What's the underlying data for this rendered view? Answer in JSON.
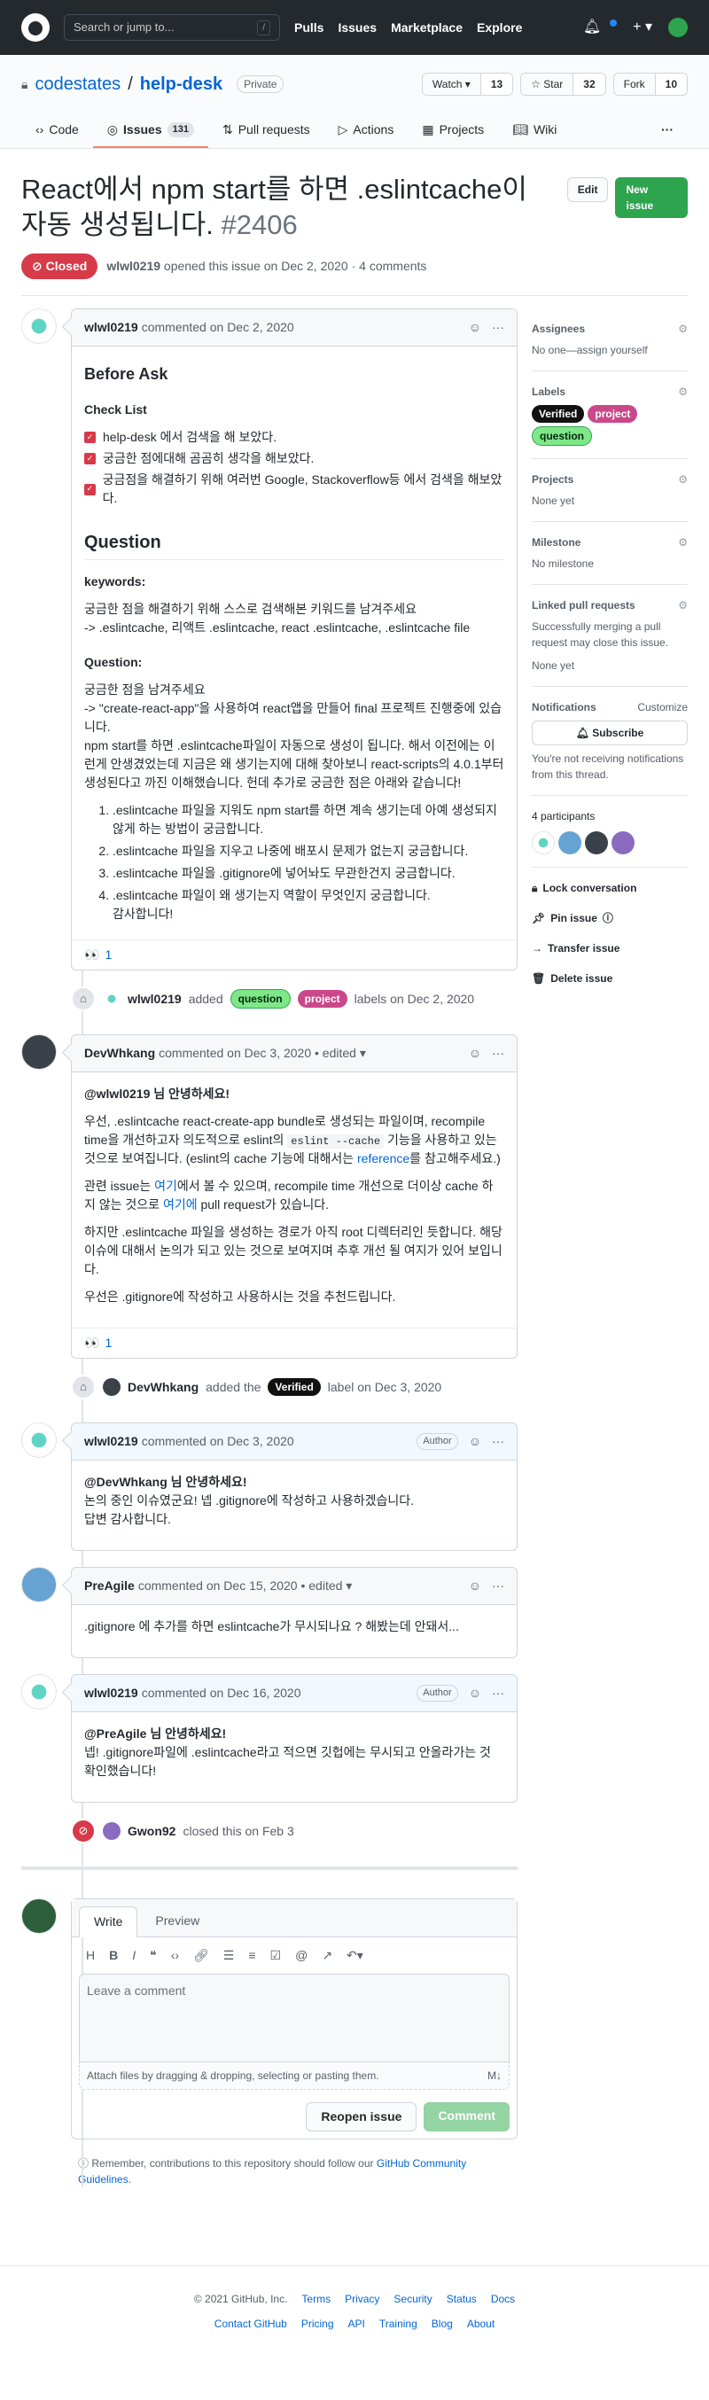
{
  "topbar": {
    "search_placeholder": "Search or jump to...",
    "search_key": "/",
    "nav": [
      "Pulls",
      "Issues",
      "Marketplace",
      "Explore"
    ],
    "plus": "+ ▾",
    "brand_color": "#24292e"
  },
  "repo": {
    "owner": "codestates",
    "sep": "/",
    "name": "help-desk",
    "visibility": "Private",
    "watch_label": "Watch ▾",
    "watch_count": "13",
    "star_label": "☆ Star",
    "star_count": "32",
    "fork_label": "Fork",
    "fork_count": "10",
    "tabs": [
      {
        "label": "Code"
      },
      {
        "label": "Issues",
        "count": "131"
      },
      {
        "label": "Pull requests"
      },
      {
        "label": "Actions"
      },
      {
        "label": "Projects"
      },
      {
        "label": "Wiki"
      }
    ],
    "more": "···"
  },
  "issue": {
    "title": "React에서 npm start를 하면 .eslintcache이 자동 생성됩니다.",
    "number": "#2406",
    "edit_label": "Edit",
    "new_label": "New issue",
    "state": "Closed",
    "opener": "wlwl0219",
    "opened_text": "opened this issue on Dec 2, 2020 · 4 comments"
  },
  "comments": {
    "c1": {
      "author": "wlwl0219",
      "when": "commented on Dec 2, 2020",
      "h_before": "Before Ask",
      "h_check": "Check List",
      "checks": [
        "help-desk 에서 검색을 해 보았다.",
        "궁금한 점에대해 곰곰히 생각을 해보았다.",
        "궁금점을 해결하기 위해 여러번 Google, Stackoverflow등 에서 검색을 해보았다."
      ],
      "h_question": "Question",
      "h_keywords": "keywords:",
      "kw1": "궁금한 점을 해결하기 위해 스스로 검색해본 키워드를 남겨주세요",
      "kw2": "-> .eslintcache, 리액트 .eslintcache, react .eslintcache, .eslintcache file",
      "h_q": "Question:",
      "q1": "궁금한 점을 남겨주세요",
      "q2": "-> \"create-react-app\"을 사용하여 react앱을 만들어 final 프로젝트 진행중에 있습니다.",
      "q3": "npm start를 하면 .eslintcache파일이 자동으로 생성이 됩니다. 해서 이전에는 이런게 안생겼었는데 지금은 왜 생기는지에 대해 찾아보니 react-scripts의 4.0.1부터 생성된다고 까진 이해했습니다. 헌데 추가로 궁금한 점은 아래와 같습니다!",
      "list": [
        ".eslintcache 파일을 지워도 npm start를 하면 계속 생기는데 아예 생성되지 않게 하는 방법이 궁금합니다.",
        ".eslintcache 파일을 지우고 나중에 배포시 문제가 없는지 궁금합니다.",
        ".eslintcache 파일을 .gitignore에 넣어놔도 무관한건지 궁금합니다.",
        ".eslintcache 파일이 왜 생기는지 역할이 무엇인지 궁금합니다."
      ],
      "thanks": "감사합니다!",
      "reaction": "👀",
      "reaction_count": "1"
    },
    "label_event": {
      "actor": "wlwl0219",
      "text1": "added",
      "l1": "question",
      "l2": "project",
      "text2": "labels on Dec 2, 2020"
    },
    "c2": {
      "author": "DevWhkang",
      "when": "commented on Dec 3, 2020 • edited ▾",
      "greet": "@wlwl0219 님 안녕하세요!",
      "p1a": "우선, .eslintcache react-create-app bundle로 생성되는 파일이며, recompile time을 개선하고자 의도적으로 eslint의 ",
      "p1code": "eslint --cache",
      "p1b": " 기능을 사용하고 있는것으로 보여집니다. (eslint의 cache 기능에 대해서는 ",
      "p1link": "reference",
      "p1c": "를 참고해주세요.)",
      "p2a": "관련 issue는 ",
      "p2l1": "여기",
      "p2b": "에서 볼 수 있으며, recompile time 개선으로 더이상 cache 하지 않는 것으로 ",
      "p2l2": "여기에",
      "p2c": " pull request가 있습니다.",
      "p3": "하지만 .eslintcache 파일을 생성하는 경로가 아직 root 디렉터리인 듯합니다. 해당 이슈에 대해서 논의가 되고 있는 것으로 보여지며 추후 개선 될 여지가 있어 보입니다.",
      "p4": "우선은 .gitignore에 작성하고 사용하시는 것을 추천드립니다.",
      "reaction": "👀",
      "reaction_count": "1"
    },
    "verified_event": {
      "actor": "DevWhkang",
      "text1": "added the",
      "label": "Verified",
      "text2": "label on Dec 3, 2020"
    },
    "c3": {
      "author": "wlwl0219",
      "when": "commented on Dec 3, 2020",
      "badge": "Author",
      "l1": "@DevWhkang 님 안녕하세요!",
      "l2": "논의 중인 이슈였군요! 넵 .gitignore에 작성하고 사용하겠습니다.",
      "l3": "답변 감사합니다."
    },
    "c4": {
      "author": "PreAgile",
      "when": "commented on Dec 15, 2020 • edited ▾",
      "text": ".gitignore 에 추가를 하면 eslintcache가 무시되나요 ? 해봤는데 안돼서..."
    },
    "c5": {
      "author": "wlwl0219",
      "when": "commented on Dec 16, 2020",
      "badge": "Author",
      "l1": "@PreAgile 님 안녕하세요!",
      "l2": "넵! .gitignore파일에 .eslintcache라고 적으면 깃헙에는 무시되고 안올라가는 것 확인했습니다!"
    },
    "close_event": {
      "actor": "Gwon92",
      "text": "closed this on Feb 3"
    }
  },
  "composer": {
    "tab_write": "Write",
    "tab_preview": "Preview",
    "placeholder": "Leave a comment",
    "attach": "Attach files by dragging & dropping, selecting or pasting them.",
    "md": "M↓",
    "reopen": "Reopen issue",
    "comment": "Comment",
    "tip_a": "Remember, contributions to this repository should follow our ",
    "tip_link": "GitHub Community Guidelines",
    "tip_b": "."
  },
  "sidebar": {
    "assignees_title": "Assignees",
    "assignees_val": "No one—assign yourself",
    "labels_title": "Labels",
    "labels": [
      "Verified",
      "project",
      "question"
    ],
    "projects_title": "Projects",
    "projects_val": "None yet",
    "milestone_title": "Milestone",
    "milestone_val": "No milestone",
    "linked_title": "Linked pull requests",
    "linked_text": "Successfully merging a pull request may close this issue.",
    "linked_val": "None yet",
    "notif_title": "Notifications",
    "notif_custom": "Customize",
    "subscribe": "Subscribe",
    "notif_text": "You're not receiving notifications from this thread.",
    "participants": "4 participants",
    "lock": "Lock conversation",
    "pin": "Pin issue",
    "transfer": "Transfer issue",
    "delete": "Delete issue"
  },
  "footer": {
    "copyright": "© 2021 GitHub, Inc.",
    "row1": [
      "Terms",
      "Privacy",
      "Security",
      "Status",
      "Docs"
    ],
    "row2": [
      "Contact GitHub",
      "Pricing",
      "API",
      "Training",
      "Blog",
      "About"
    ]
  }
}
